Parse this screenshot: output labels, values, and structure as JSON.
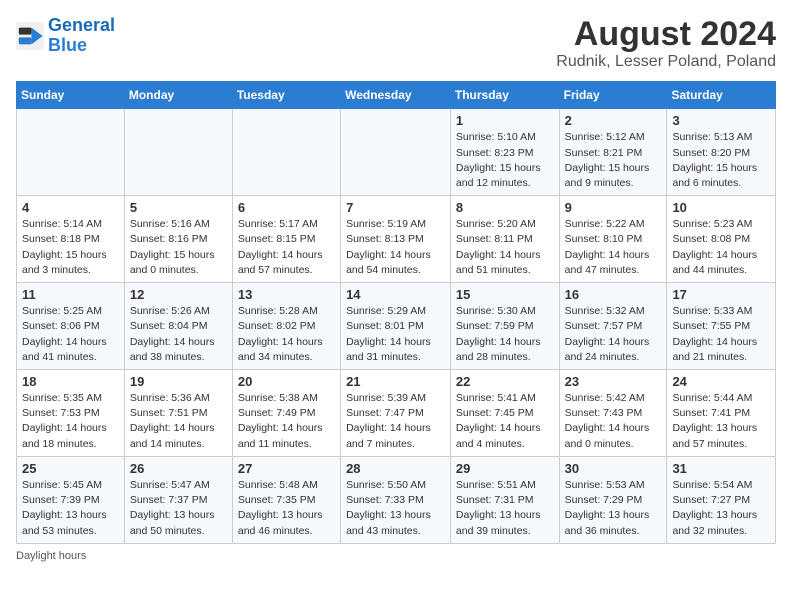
{
  "header": {
    "logo_line1": "General",
    "logo_line2": "Blue",
    "month_year": "August 2024",
    "location": "Rudnik, Lesser Poland, Poland"
  },
  "days_of_week": [
    "Sunday",
    "Monday",
    "Tuesday",
    "Wednesday",
    "Thursday",
    "Friday",
    "Saturday"
  ],
  "weeks": [
    [
      {
        "day": "",
        "info": ""
      },
      {
        "day": "",
        "info": ""
      },
      {
        "day": "",
        "info": ""
      },
      {
        "day": "",
        "info": ""
      },
      {
        "day": "1",
        "info": "Sunrise: 5:10 AM\nSunset: 8:23 PM\nDaylight: 15 hours and 12 minutes."
      },
      {
        "day": "2",
        "info": "Sunrise: 5:12 AM\nSunset: 8:21 PM\nDaylight: 15 hours and 9 minutes."
      },
      {
        "day": "3",
        "info": "Sunrise: 5:13 AM\nSunset: 8:20 PM\nDaylight: 15 hours and 6 minutes."
      }
    ],
    [
      {
        "day": "4",
        "info": "Sunrise: 5:14 AM\nSunset: 8:18 PM\nDaylight: 15 hours and 3 minutes."
      },
      {
        "day": "5",
        "info": "Sunrise: 5:16 AM\nSunset: 8:16 PM\nDaylight: 15 hours and 0 minutes."
      },
      {
        "day": "6",
        "info": "Sunrise: 5:17 AM\nSunset: 8:15 PM\nDaylight: 14 hours and 57 minutes."
      },
      {
        "day": "7",
        "info": "Sunrise: 5:19 AM\nSunset: 8:13 PM\nDaylight: 14 hours and 54 minutes."
      },
      {
        "day": "8",
        "info": "Sunrise: 5:20 AM\nSunset: 8:11 PM\nDaylight: 14 hours and 51 minutes."
      },
      {
        "day": "9",
        "info": "Sunrise: 5:22 AM\nSunset: 8:10 PM\nDaylight: 14 hours and 47 minutes."
      },
      {
        "day": "10",
        "info": "Sunrise: 5:23 AM\nSunset: 8:08 PM\nDaylight: 14 hours and 44 minutes."
      }
    ],
    [
      {
        "day": "11",
        "info": "Sunrise: 5:25 AM\nSunset: 8:06 PM\nDaylight: 14 hours and 41 minutes."
      },
      {
        "day": "12",
        "info": "Sunrise: 5:26 AM\nSunset: 8:04 PM\nDaylight: 14 hours and 38 minutes."
      },
      {
        "day": "13",
        "info": "Sunrise: 5:28 AM\nSunset: 8:02 PM\nDaylight: 14 hours and 34 minutes."
      },
      {
        "day": "14",
        "info": "Sunrise: 5:29 AM\nSunset: 8:01 PM\nDaylight: 14 hours and 31 minutes."
      },
      {
        "day": "15",
        "info": "Sunrise: 5:30 AM\nSunset: 7:59 PM\nDaylight: 14 hours and 28 minutes."
      },
      {
        "day": "16",
        "info": "Sunrise: 5:32 AM\nSunset: 7:57 PM\nDaylight: 14 hours and 24 minutes."
      },
      {
        "day": "17",
        "info": "Sunrise: 5:33 AM\nSunset: 7:55 PM\nDaylight: 14 hours and 21 minutes."
      }
    ],
    [
      {
        "day": "18",
        "info": "Sunrise: 5:35 AM\nSunset: 7:53 PM\nDaylight: 14 hours and 18 minutes."
      },
      {
        "day": "19",
        "info": "Sunrise: 5:36 AM\nSunset: 7:51 PM\nDaylight: 14 hours and 14 minutes."
      },
      {
        "day": "20",
        "info": "Sunrise: 5:38 AM\nSunset: 7:49 PM\nDaylight: 14 hours and 11 minutes."
      },
      {
        "day": "21",
        "info": "Sunrise: 5:39 AM\nSunset: 7:47 PM\nDaylight: 14 hours and 7 minutes."
      },
      {
        "day": "22",
        "info": "Sunrise: 5:41 AM\nSunset: 7:45 PM\nDaylight: 14 hours and 4 minutes."
      },
      {
        "day": "23",
        "info": "Sunrise: 5:42 AM\nSunset: 7:43 PM\nDaylight: 14 hours and 0 minutes."
      },
      {
        "day": "24",
        "info": "Sunrise: 5:44 AM\nSunset: 7:41 PM\nDaylight: 13 hours and 57 minutes."
      }
    ],
    [
      {
        "day": "25",
        "info": "Sunrise: 5:45 AM\nSunset: 7:39 PM\nDaylight: 13 hours and 53 minutes."
      },
      {
        "day": "26",
        "info": "Sunrise: 5:47 AM\nSunset: 7:37 PM\nDaylight: 13 hours and 50 minutes."
      },
      {
        "day": "27",
        "info": "Sunrise: 5:48 AM\nSunset: 7:35 PM\nDaylight: 13 hours and 46 minutes."
      },
      {
        "day": "28",
        "info": "Sunrise: 5:50 AM\nSunset: 7:33 PM\nDaylight: 13 hours and 43 minutes."
      },
      {
        "day": "29",
        "info": "Sunrise: 5:51 AM\nSunset: 7:31 PM\nDaylight: 13 hours and 39 minutes."
      },
      {
        "day": "30",
        "info": "Sunrise: 5:53 AM\nSunset: 7:29 PM\nDaylight: 13 hours and 36 minutes."
      },
      {
        "day": "31",
        "info": "Sunrise: 5:54 AM\nSunset: 7:27 PM\nDaylight: 13 hours and 32 minutes."
      }
    ]
  ],
  "footer": "Daylight hours"
}
